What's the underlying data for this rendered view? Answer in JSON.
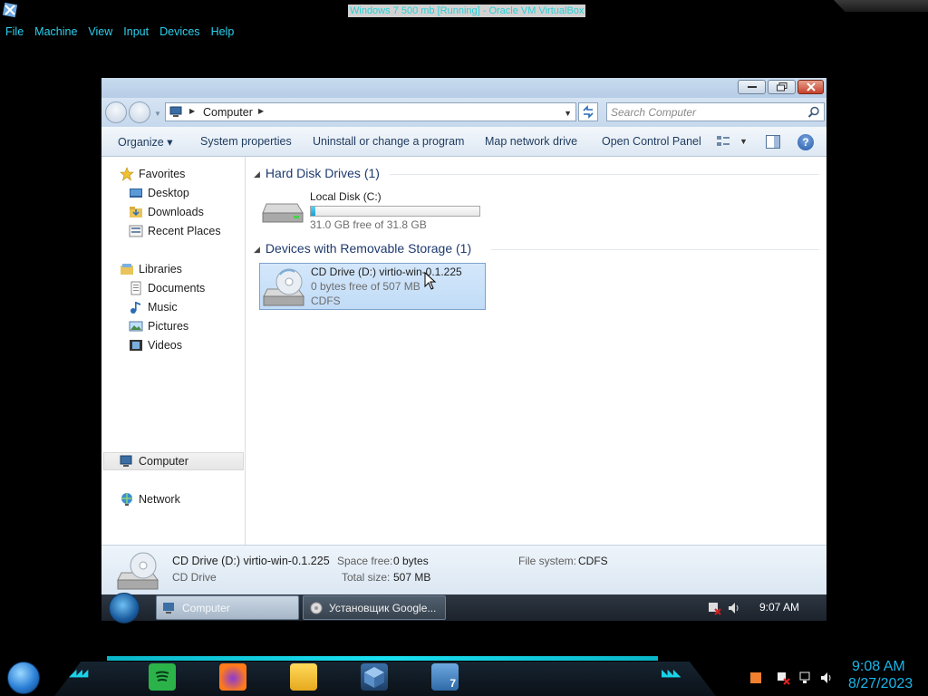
{
  "host": {
    "title": "Windows 7 500 mb [Running] - Oracle VM VirtualBox",
    "menu": [
      "File",
      "Machine",
      "View",
      "Input",
      "Devices",
      "Help"
    ]
  },
  "explorer": {
    "address": {
      "location": "Computer"
    },
    "search": {
      "placeholder": "Search Computer"
    },
    "commands": {
      "organize": "Organize ▾",
      "system_properties": "System properties",
      "uninstall": "Uninstall or change a program",
      "map_network_drive": "Map network drive",
      "open_control_panel": "Open Control Panel",
      "help": "?"
    },
    "nav": {
      "favorites": "Favorites",
      "desktop": "Desktop",
      "downloads": "Downloads",
      "recent_places": "Recent Places",
      "libraries": "Libraries",
      "documents": "Documents",
      "music": "Music",
      "pictures": "Pictures",
      "videos": "Videos",
      "computer": "Computer",
      "network": "Network"
    },
    "groups": {
      "hard_disk": {
        "header": "Hard Disk Drives (1)",
        "drive": {
          "name": "Local Disk (C:)",
          "free_text": "31.0 GB free of 31.8 GB",
          "used_fraction": 0.025
        }
      },
      "removable": {
        "header": "Devices with Removable Storage (1)",
        "drive": {
          "name": "CD Drive (D:) virtio-win-0.1.225",
          "free_text": "0 bytes free of 507 MB",
          "filesystem": "CDFS"
        }
      }
    },
    "details": {
      "name": "CD Drive (D:) virtio-win-0.1.225",
      "type": "CD Drive",
      "space_free_label": "Space free:",
      "space_free_value": "0 bytes",
      "total_size_label": "Total size:",
      "total_size_value": "507 MB",
      "filesystem_label": "File system:",
      "filesystem_value": "CDFS"
    }
  },
  "guest_taskbar": {
    "tasks": [
      "Computer",
      "Установщик Google..."
    ],
    "clock": "9:07 AM"
  },
  "host_taskbar": {
    "time": "9:08 AM",
    "date": "8/27/2023",
    "vbox_badge": "7"
  },
  "colors": {
    "host_accent": "#19b5e8",
    "explorer_header": "#1e3a6e",
    "selection": "#c1dcf7"
  }
}
